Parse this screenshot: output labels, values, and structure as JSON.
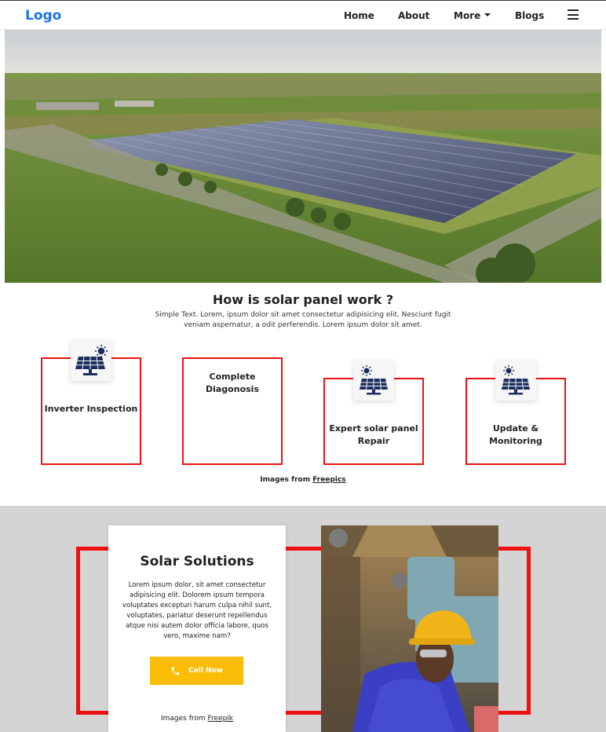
{
  "nav": {
    "logo": "Logo",
    "links": [
      "Home",
      "About",
      "More",
      "Blogs"
    ]
  },
  "hero": {
    "image": "aerial-solar-farm-photo"
  },
  "how": {
    "title": "How is solar panel work ?",
    "description": "Simple Text. Lorem, ipsum dolor sit amet consectetur adipisicing elit. Nesciunt fugit veniam aspernatur, a odit perferendis. Lorem ipsum dolor sit amet.",
    "cards": [
      {
        "label": "Inverter Inspection",
        "icon": "solar-panel-icon"
      },
      {
        "label": "Complete Diagonosis",
        "icon": ""
      },
      {
        "label": "Expert solar panel Repair",
        "icon": "solar-panel-icon"
      },
      {
        "label": "Update & Monitoring",
        "icon": "solar-panel-icon"
      }
    ],
    "credit_prefix": "Images from ",
    "credit_link": "Freepics"
  },
  "solutions": {
    "title": "Solar Solutions",
    "text": "Lorem ipsum dolor, sit amet consectetur adipisicing elit. Dolorem ipsum tempora voluptates excepturi harum culpa nihil sunt, voluptates, pariatur deserunt repellendus atque nisi autem dolor officia labore, quos vero, maxime nam?",
    "button": "Call Now",
    "credit_prefix": "Images from ",
    "credit_link": "Freepik",
    "image": "worker-in-hard-hat-photo"
  },
  "colors": {
    "accent_red": "#ee1111",
    "logo_blue": "#1a73e8",
    "button_yellow": "#fbbd08",
    "section_gray": "#d4d4d4",
    "icon_navy": "#1b2f5e"
  }
}
